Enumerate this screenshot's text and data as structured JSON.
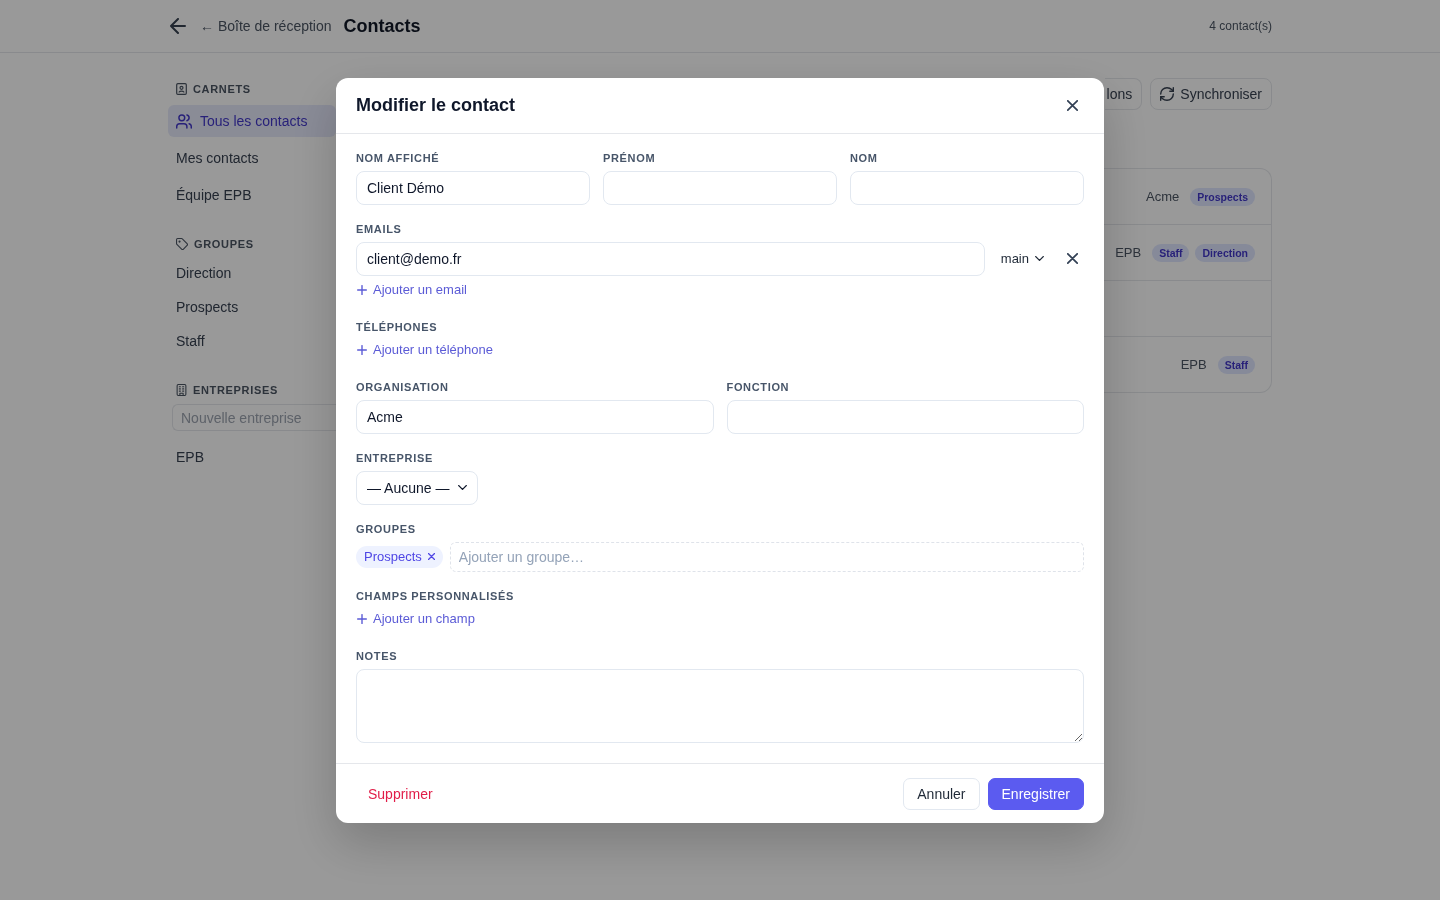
{
  "top_bar": {
    "back_link": "← Boîte de réception",
    "title": "Contacts",
    "count": "4 contact(s)"
  },
  "sidebar": {
    "sections": [
      {
        "kind": "books",
        "title": "CARNETS",
        "items": [
          {
            "kind": "all",
            "label": "Tous les contacts",
            "selected": true
          },
          {
            "kind": "book",
            "label": "Mes contacts",
            "selected": false
          },
          {
            "kind": "book",
            "label": "Équipe EPB",
            "selected": false
          }
        ]
      },
      {
        "kind": "groups",
        "title": "GROUPES",
        "items": [
          {
            "label": "Direction",
            "selected": false
          },
          {
            "label": "Prospects",
            "selected": false
          },
          {
            "label": "Staff",
            "selected": false
          }
        ]
      },
      {
        "kind": "companies",
        "title": "ENTREPRISES",
        "placeholder": "Nouvelle entreprise",
        "items": [
          {
            "label": "EPB",
            "selected": false
          }
        ]
      }
    ]
  },
  "toolbar": {
    "buttons": [
      {
        "kind": "plain",
        "label": "lons"
      },
      {
        "kind": "sync",
        "label": "Synchroniser"
      }
    ]
  },
  "contacts_table": {
    "rows": [
      {
        "company": "Acme",
        "groups": [
          "Prospects"
        ]
      },
      {
        "company": "EPB",
        "groups": [
          "Staff",
          "Direction"
        ]
      },
      {},
      {
        "company": "EPB",
        "groups": [
          "Staff"
        ]
      }
    ]
  },
  "dialog": {
    "title": "Modifier le contact",
    "name_fields": [
      {
        "label": "NOM AFFICHÉ",
        "value": "Client Démo"
      },
      {
        "label": "PRÉNOM"
      },
      {
        "label": "NOM"
      }
    ],
    "emails": {
      "label": "EMAILS",
      "entries": [
        {
          "value": "client@demo.fr",
          "type": "main"
        }
      ],
      "add_link": "Ajouter un email"
    },
    "phones": {
      "label": "TÉLÉPHONES",
      "add_link": "Ajouter un téléphone"
    },
    "work_fields": [
      {
        "label": "ORGANISATION",
        "value": "Acme"
      },
      {
        "label": "FONCTION"
      }
    ],
    "company": {
      "label": "ENTREPRISE",
      "value": "— Aucune —"
    },
    "groups": {
      "label": "GROUPES",
      "tags": [
        "Prospects"
      ],
      "placeholder": "Ajouter un groupe…"
    },
    "custom_fields": {
      "label": "CHAMPS PERSONNALISÉS",
      "add_link": "Ajouter un champ"
    },
    "notes": {
      "label": "NOTES"
    },
    "buttons": [
      {
        "kind": "danger",
        "label": "Supprimer"
      },
      {
        "kind": "secondary",
        "label": "Annuler"
      },
      {
        "kind": "primary",
        "label": "Enregistrer"
      }
    ]
  }
}
